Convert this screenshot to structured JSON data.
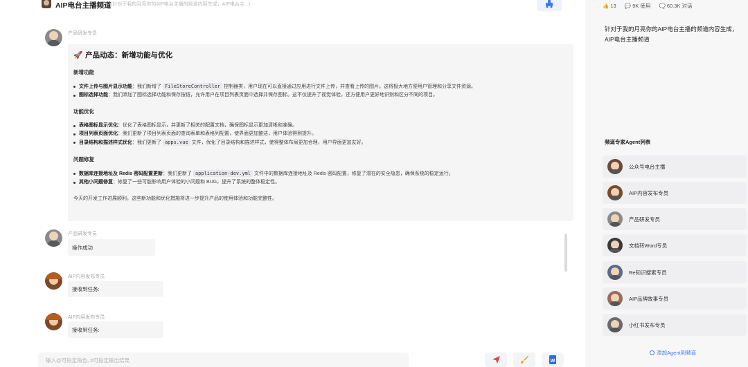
{
  "header": {
    "title": "AIP电台主播频道",
    "description": "(针对于我的月亮你的AIP电台主播的频道内容生成，AIP电台主...)"
  },
  "messages": [
    {
      "sender": "产品研发专员",
      "title": "产品动态：新增功能与优化",
      "sections": [
        {
          "heading": "新增功能",
          "items": [
            {
              "label": "文件上传与图片显示功能",
              "pre": "：我们新增了 ",
              "code": "FileStoreController",
              "post": " 控制器类，用户现在可以直接通过应用进行文件上传，并查看上传的图片。这将极大地方便用户管理和分享文件资源。"
            },
            {
              "label": "图标选择功能",
              "pre": "：我们添加了图标选择功能和保存按钮，允许用户在项目列表页面中选择并保存图标。这不仅提升了视觉体验，还方便用户更好地识别和区分不同的项目。",
              "code": "",
              "post": ""
            }
          ]
        },
        {
          "heading": "功能优化",
          "items": [
            {
              "label": "表格图标显示优化",
              "pre": "：优化了表格图标显示，并更新了相关的配置文档，确保图标显示更加清晰和准确。",
              "code": "",
              "post": ""
            },
            {
              "label": "项目列表页面优化",
              "pre": "：我们更新了项目列表页面的查询表单和表格列配置，使界面更加整洁，用户体验得到提升。",
              "code": "",
              "post": ""
            },
            {
              "label": "目录结构和描述样式优化",
              "pre": "：我们更新了 ",
              "code": "apps.vue",
              "post": " 文件，优化了目录结构和描述样式，使得整体布局更加合理，用户界面更加友好。"
            }
          ]
        },
        {
          "heading": "问题修复",
          "items": [
            {
              "label": "数据库连接地址及 Redis 密码配置更新",
              "pre": "：我们更新了 ",
              "code": "application-dev.yml",
              "post": " 文件中的数据库连接地址及 Redis 密码配置，修复了潜在的安全隐患，确保系统的稳定运行。"
            },
            {
              "label": "其他小问题修复",
              "pre": "：修复了一些可能影响用户体验的小问题和 BUG，提升了系统的整体稳定性。",
              "code": "",
              "post": ""
            }
          ]
        }
      ],
      "closing": "今天的开发工作进展顺利，这些新功能和优化措施将进一步提升产品的使用体验和功能完整性。"
    },
    {
      "sender": "产品研发专员",
      "text": "操作成功"
    },
    {
      "sender": "AIP内容发布专员",
      "text": "接收到任务:"
    },
    {
      "sender": "AIP内容发布专员",
      "text": "接收到任务:"
    }
  ],
  "input": {
    "placeholder": "输入@可指定角色, #可指定输出结果"
  },
  "stats": {
    "likes": "13",
    "usage": "9K 使用",
    "conversations": "60.3K 对话"
  },
  "right_description": "针对于我的月亮你的AIP电台主播的频道内容生成，AIP电台主播频道",
  "agent_list_title": "频道专家Agent列表",
  "agents": [
    {
      "name": "公众号电台主播",
      "color": "#6b4a3a"
    },
    {
      "name": "AIP内容发布专员",
      "color": "#7a4a2a"
    },
    {
      "name": "产品研发专员",
      "color": "#8a8a8a"
    },
    {
      "name": "文档转Word专员",
      "color": "#3a3a3a"
    },
    {
      "name": "Re知识搜索专员",
      "color": "#5a6a8a"
    },
    {
      "name": "AIP品牌故事专员",
      "color": "#9a6a5a"
    },
    {
      "name": "小红书发布专员",
      "color": "#6a6a6a"
    }
  ],
  "add_agent_label": "添加Agent到频道",
  "colors": {
    "accent": "#3c7bf5",
    "send": "#e0443a",
    "brush": "#f09a1c",
    "word": "#2b6fdc"
  }
}
